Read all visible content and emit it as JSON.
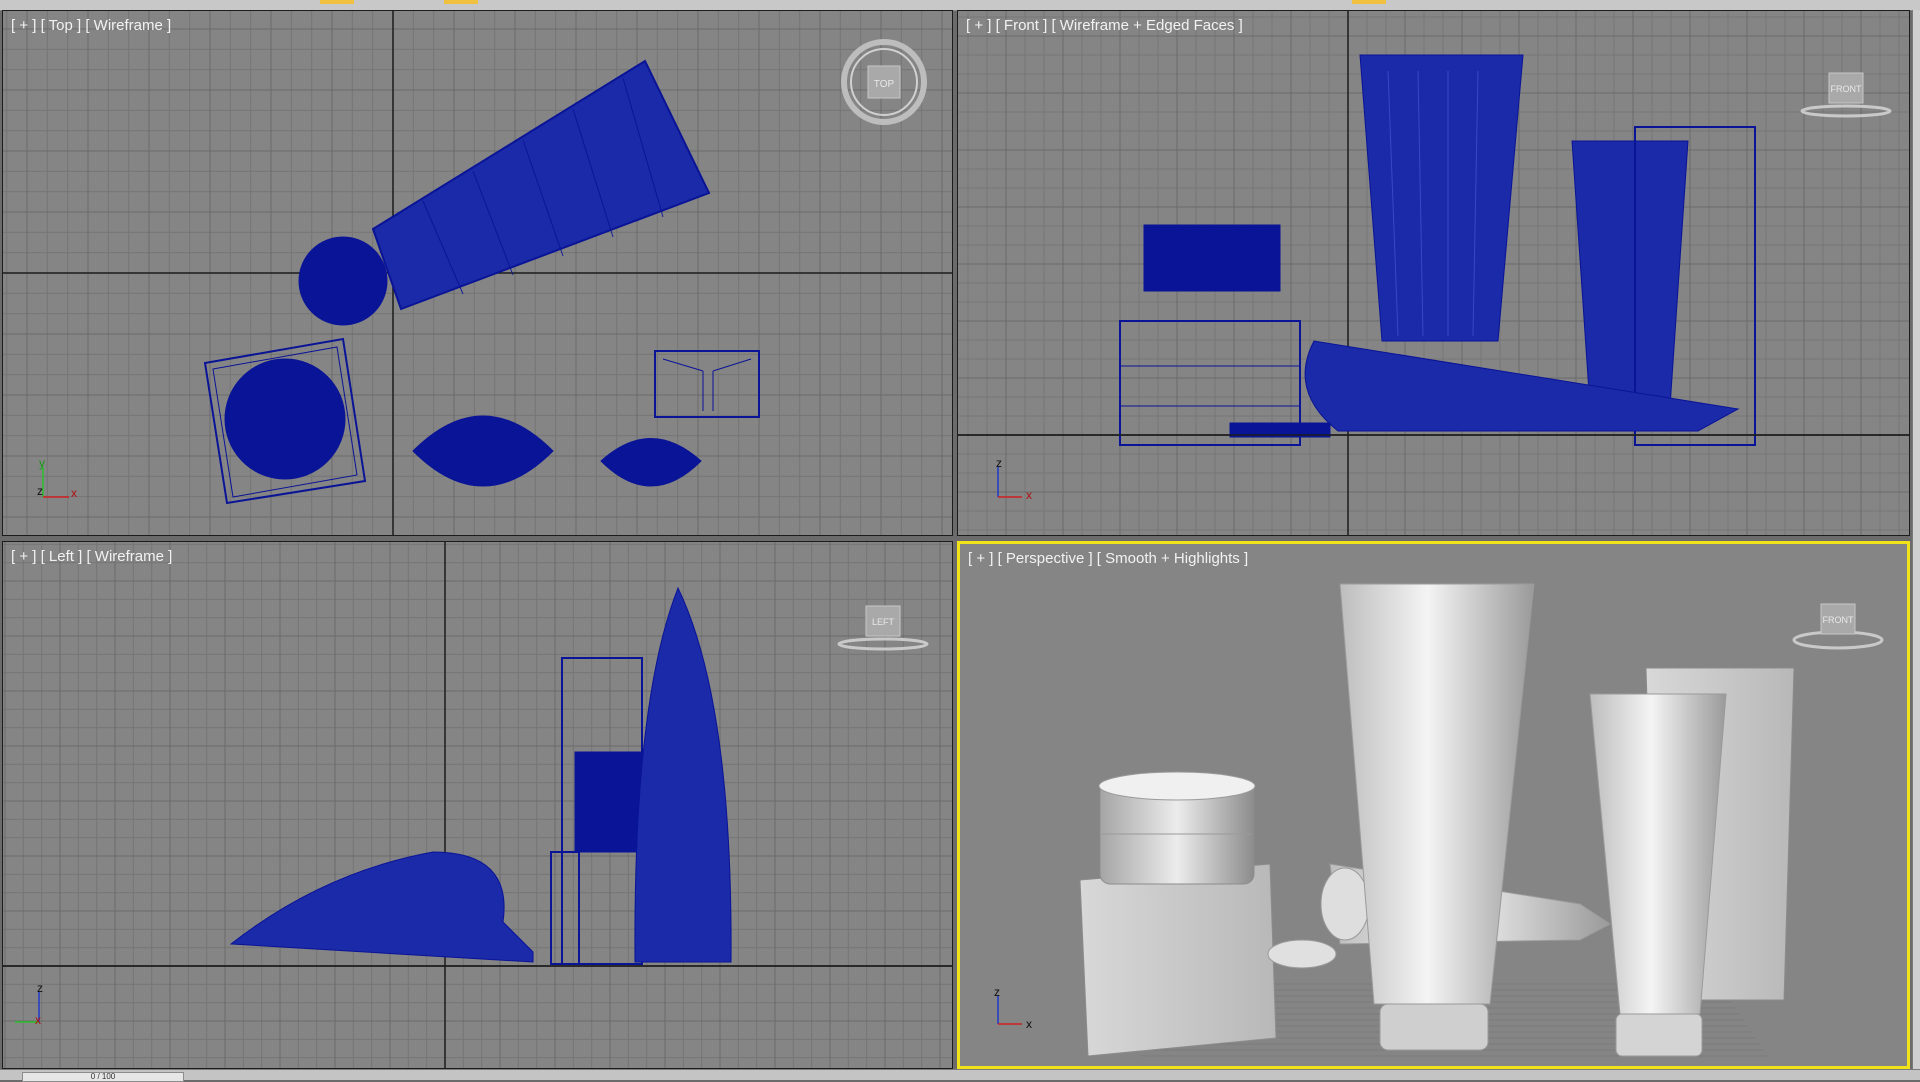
{
  "viewports": {
    "top": {
      "label": "[ + ] [ Top ] [ Wireframe ]",
      "cube": "TOP",
      "axes": [
        "z",
        "x",
        "y"
      ]
    },
    "front": {
      "label": "[ + ] [ Front ] [ Wireframe + Edged Faces ]",
      "cube": "FRONT",
      "axes": [
        "z",
        "x"
      ]
    },
    "left": {
      "label": "[ + ] [ Left ] [ Wireframe ]",
      "cube": "LEFT",
      "axes": [
        "z",
        "x"
      ]
    },
    "persp": {
      "label": "[ + ] [ Perspective ] [ Smooth + Highlights ]",
      "cube": "FRONT",
      "axes": [
        "z",
        "x"
      ]
    }
  },
  "timeline": {
    "frame": "0 / 100"
  },
  "colors": {
    "viewport_bg": "#858585",
    "grid_minor": "#767676",
    "grid_major": "#1c1c1c",
    "wire": "#0a1496",
    "active_border": "#f2e21a"
  },
  "icons": [
    "viewcube-top-icon",
    "viewcube-front-icon",
    "viewcube-left-icon",
    "axis-tripod-icon"
  ]
}
